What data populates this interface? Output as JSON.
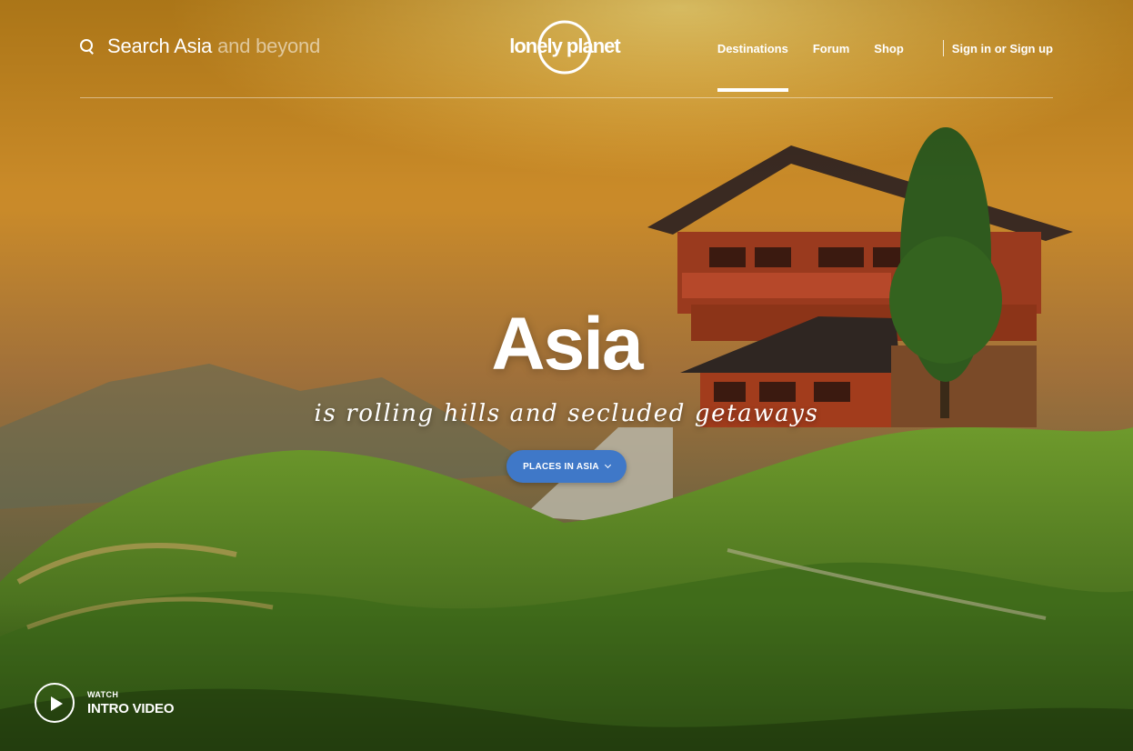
{
  "search": {
    "text_primary": "Search Asia",
    "text_secondary": "and beyond",
    "icon": "search-icon"
  },
  "brand": {
    "logo_text": "lonely planet"
  },
  "nav": {
    "items": [
      {
        "label": "Destinations",
        "active": true
      },
      {
        "label": "Forum",
        "active": false
      },
      {
        "label": "Shop",
        "active": false
      }
    ],
    "sign_in": "Sign in or Sign up"
  },
  "hero": {
    "title": "Asia",
    "subtitle": "is rolling hills and secluded getaways",
    "cta_label": "PLACES IN ASIA",
    "cta_icon": "chevron-down-icon",
    "cta_color": "#3f78c8"
  },
  "video": {
    "kicker": "WATCH",
    "title": "INTRO VIDEO",
    "icon": "play-icon"
  }
}
